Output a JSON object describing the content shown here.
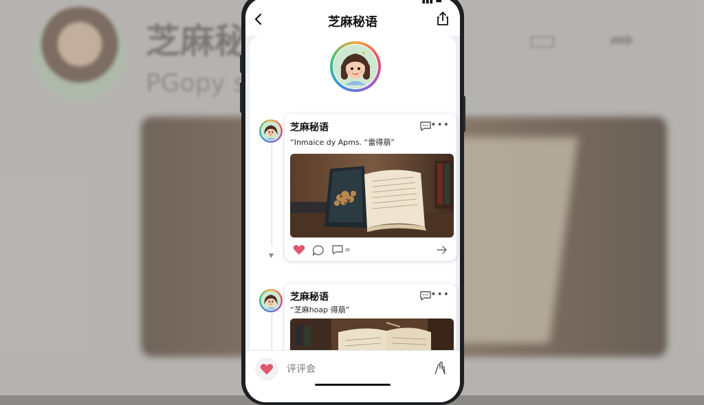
{
  "app": {
    "title": "芝麻秘语",
    "status_text": "▮▮▮ ▬"
  },
  "background": {
    "title": "芝麻秘",
    "subtitle": "PGopy s“ 雷萠”"
  },
  "posts": [
    {
      "name": "芝麻秘语",
      "text": "“Inmaice dy Apms. “雷得萠”"
    },
    {
      "name": "芝麻秘语",
      "text": "“芝麻hoap 得萠”"
    }
  ],
  "post_actions": {
    "reply_count_label": "ⴰ"
  },
  "bottom_bar": {
    "comment_placeholder": "评评会"
  },
  "colors": {
    "like": "#e0566c",
    "accent_ring": [
      "#f2a93b",
      "#e64d6a",
      "#9b59d0",
      "#3b8fe6",
      "#42c37b"
    ]
  },
  "icons": [
    "back-icon",
    "share-icon",
    "comment-icon",
    "more-icon",
    "heart-icon",
    "reply-icon",
    "forward-icon",
    "clap-icon"
  ]
}
